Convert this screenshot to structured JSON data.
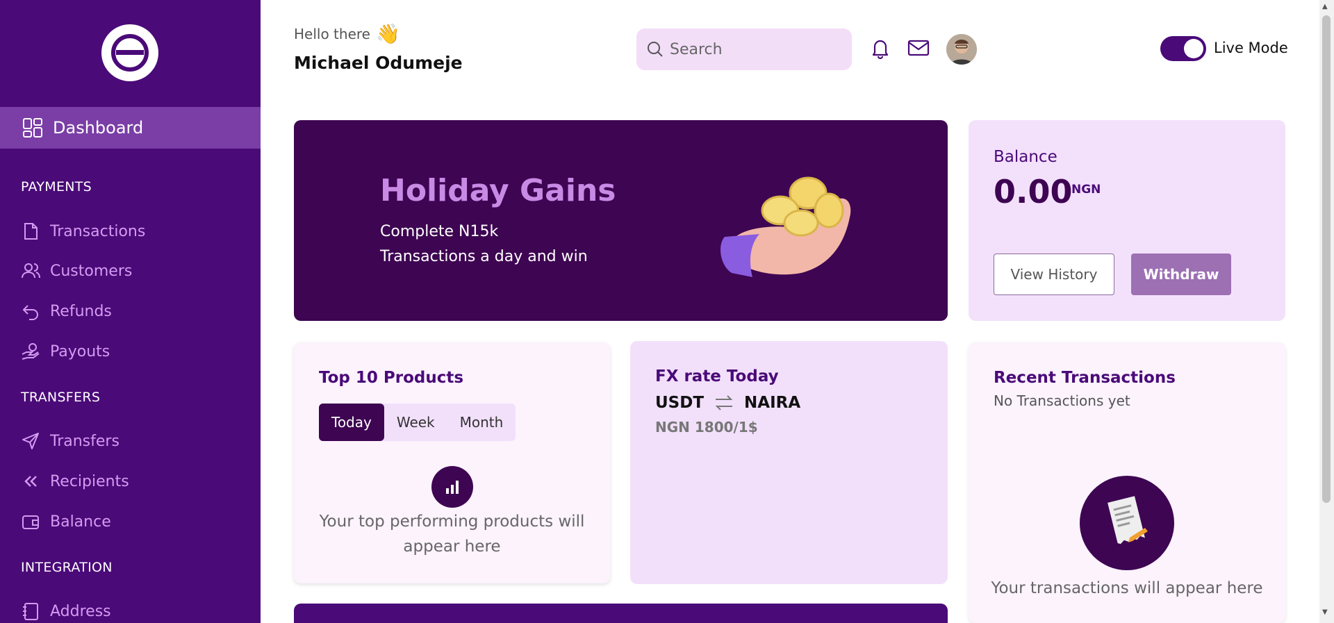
{
  "sidebar": {
    "active": {
      "label": "Dashboard",
      "icon": "grid-icon"
    },
    "sections": [
      {
        "title": "PAYMENTS",
        "items": [
          {
            "label": "Transactions",
            "icon": "document-icon"
          },
          {
            "label": "Customers",
            "icon": "users-icon"
          },
          {
            "label": "Refunds",
            "icon": "undo-icon"
          },
          {
            "label": "Payouts",
            "icon": "hand-coin-icon"
          }
        ]
      },
      {
        "title": "TRANSFERS",
        "items": [
          {
            "label": "Transfers",
            "icon": "send-icon"
          },
          {
            "label": "Recipients",
            "icon": "chevrons-left-icon"
          },
          {
            "label": "Balance",
            "icon": "wallet-icon"
          }
        ]
      },
      {
        "title": "INTEGRATION",
        "items": [
          {
            "label": "Address",
            "icon": "address-book-icon"
          }
        ]
      }
    ]
  },
  "header": {
    "greeting": "Hello there",
    "wave_emoji": "👋",
    "user_name": "Michael Odumeje",
    "search_placeholder": "Search",
    "live_mode_label": "Live Mode",
    "live_mode_on": true
  },
  "banner": {
    "title": "Holiday Gains",
    "line1": "Complete N15k",
    "line2": "Transactions a day and win"
  },
  "balance": {
    "heading": "Balance",
    "amount": "0.00",
    "currency": "NGN",
    "view_history_label": "View History",
    "withdraw_label": "Withdraw"
  },
  "top_products": {
    "heading": "Top 10 Products",
    "tabs": [
      "Today",
      "Week",
      "Month"
    ],
    "active_tab": "Today",
    "empty_line1": "Your top performing products will",
    "empty_line2": "appear here"
  },
  "fx": {
    "heading": "FX rate Today",
    "from": "USDT",
    "to": "NAIRA",
    "rate": "NGN 1800/1$"
  },
  "recent": {
    "heading": "Recent Transactions",
    "subtitle": "No Transactions yet",
    "empty_text": "Your transactions will appear here"
  },
  "colors": {
    "sidebar": "#4a0a78",
    "accent_dark": "#3e0552",
    "accent_light": "#f3e1fb",
    "nav_text": "#d39cf0"
  }
}
